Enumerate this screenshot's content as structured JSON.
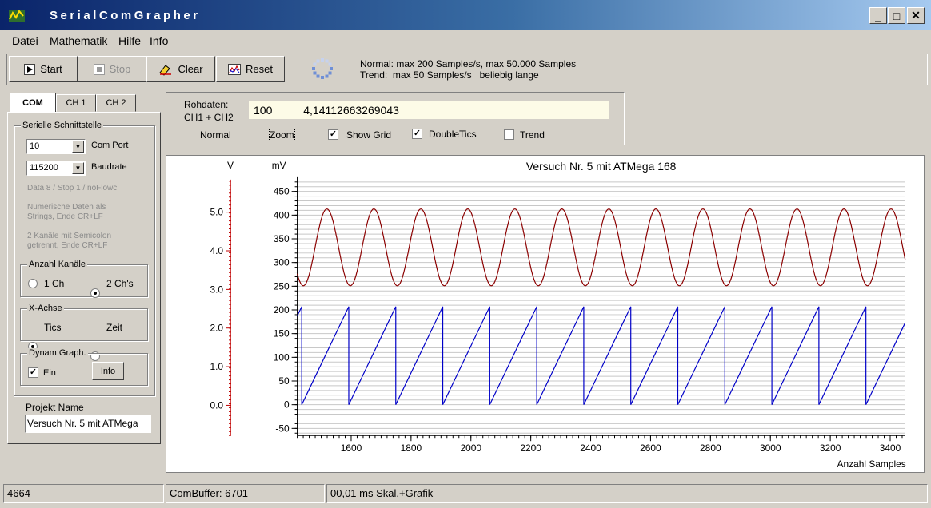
{
  "window": {
    "title": "SerialComGrapher",
    "minimize": "_",
    "maximize": "□",
    "close": "✕"
  },
  "menu": [
    "Datei",
    "Mathematik",
    "Hilfe",
    "Info"
  ],
  "toolbar": {
    "start": "Start",
    "stop": "Stop",
    "clear": "Clear",
    "reset": "Reset",
    "info_line1": "Normal: max 200 Samples/s, max 50.000 Samples",
    "info_line2": "Trend:  max 50 Samples/s   beliebig lange"
  },
  "tabs": [
    "COM",
    "CH 1",
    "CH 2"
  ],
  "com": {
    "group_title": "Serielle Schnittstelle",
    "port_value": "10",
    "port_label": "Com Port",
    "baud_value": "115200",
    "baud_label": "Baudrate",
    "note1": "Data 8 / Stop 1 / noFlowc",
    "note2_a": "Numerische Daten als",
    "note2_b": "Strings, Ende CR+LF",
    "note3_a": "2 Kanäle mit Semicolon",
    "note3_b": "getrennt, Ende CR+LF",
    "channels_title": "Anzahl Kanäle",
    "ch1": "1 Ch",
    "ch2": "2 Ch's",
    "xaxis_title": "X-Achse",
    "tics": "Tics",
    "zeit": "Zeit",
    "dyn_title": "Dynam.Graph.",
    "ein": "Ein",
    "info_button": "Info",
    "project_label": "Projekt Name",
    "project_value": "Versuch Nr. 5  mit ATMega"
  },
  "raw": {
    "label1": "Rohdaten:",
    "label2": "CH1 + CH2",
    "value": "100          4,14112663269043",
    "normal": "Normal",
    "zoom": "Zoom",
    "show_grid": "Show Grid",
    "double_tics": "DoubleTics",
    "trend": "Trend"
  },
  "status": {
    "count": "4664",
    "buffer": "ComBuffer: 6701",
    "timing": "00,01 ms Skal.+Grafik"
  },
  "chart_data": {
    "type": "line",
    "title": "Versuch Nr. 5  mit ATMega 168",
    "xlabel": "Anzahl Samples",
    "left_unit": "V",
    "right_unit": "mV",
    "xlim": [
      1420,
      3450
    ],
    "xticks": [
      1600,
      1800,
      2000,
      2200,
      2400,
      2600,
      2800,
      3000,
      3200,
      3400
    ],
    "ylim": [
      -65,
      475
    ],
    "yticks": [
      -50,
      0,
      50,
      100,
      150,
      200,
      250,
      300,
      350,
      400,
      450
    ],
    "vticks": [
      "0.0",
      "1.0",
      "2.0",
      "3.0",
      "4.0",
      "5.0"
    ],
    "grid": true,
    "series": [
      {
        "shape": "sine",
        "color": "#8b0000",
        "center": 332,
        "amplitude": 81,
        "period": 157,
        "x0": 1420,
        "y0_phase": 0.0
      },
      {
        "shape": "sawtooth",
        "color": "#0000c8",
        "min": 0,
        "max": 207,
        "period": 157,
        "first_reset": 1435
      }
    ]
  }
}
